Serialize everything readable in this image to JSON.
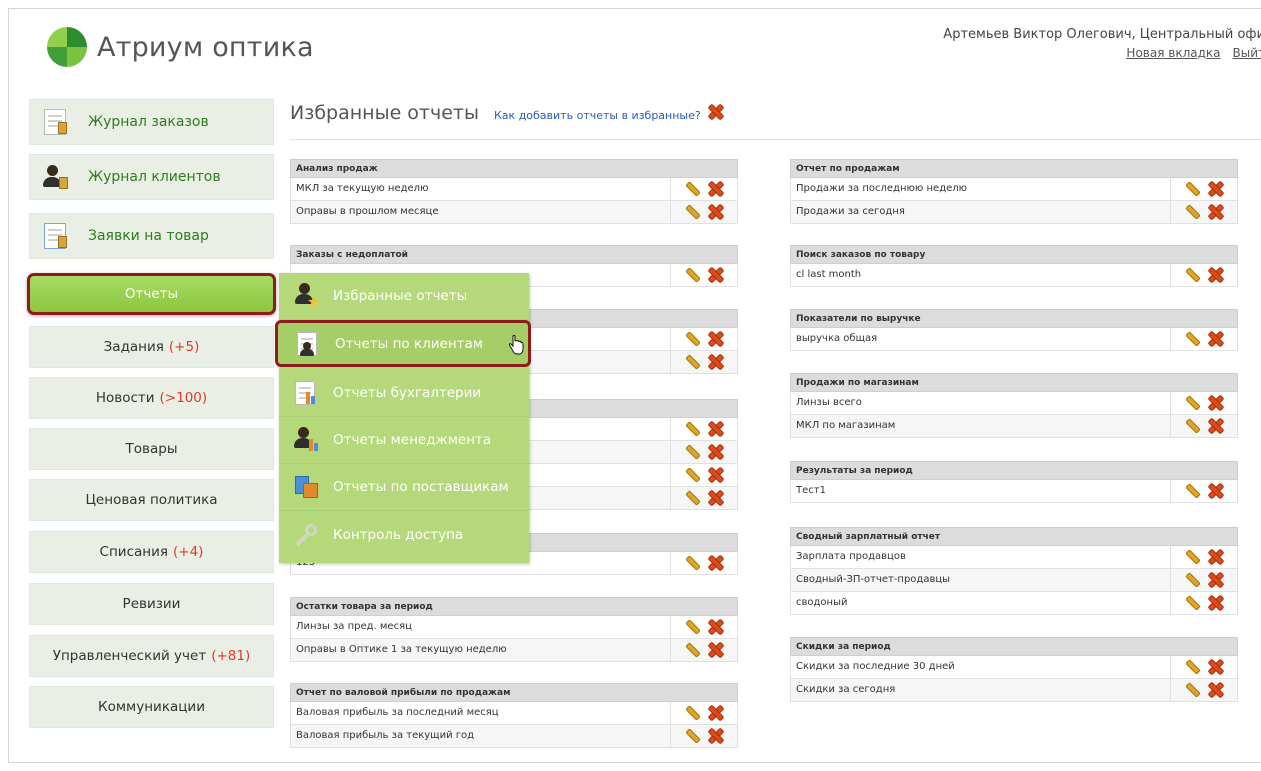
{
  "header": {
    "app_title": "Атриум оптика",
    "user": "Артемьев Виктор Олегович, Центральный офи",
    "links": [
      "Новая вкладка",
      "Выйт"
    ]
  },
  "sidebar": {
    "items": [
      {
        "label": "Журнал заказов",
        "count": ""
      },
      {
        "label": "Журнал клиентов",
        "count": ""
      },
      {
        "label": "Заявки на товар",
        "count": ""
      },
      {
        "label": "Отчеты",
        "count": ""
      },
      {
        "label": "Задания",
        "count": "(+5)"
      },
      {
        "label": "Новости",
        "count": "(>100)"
      },
      {
        "label": "Товары",
        "count": ""
      },
      {
        "label": "Ценовая политика",
        "count": ""
      },
      {
        "label": "Списания",
        "count": "(+4)"
      },
      {
        "label": "Ревизии",
        "count": ""
      },
      {
        "label": "Управленческий учет",
        "count": "(+81)"
      },
      {
        "label": "Коммуникации",
        "count": ""
      }
    ]
  },
  "menu": {
    "items": [
      {
        "label": "Избранные отчеты"
      },
      {
        "label": "Отчеты по клиентам"
      },
      {
        "label": "Отчеты бухгалтерии"
      },
      {
        "label": "Отчеты менеджмента"
      },
      {
        "label": "Отчеты по поставщикам"
      },
      {
        "label": "Контроль доступа"
      }
    ]
  },
  "content": {
    "title": "Избранные отчеты",
    "help_link": "Как добавить отчеты в избранные?"
  },
  "left_groups": [
    {
      "title": "Анализ продаж",
      "rows": [
        "МКЛ за текущую неделю",
        "Оправы в прошлом месяце"
      ]
    },
    {
      "title": "Заказы с недоплатой",
      "rows": [
        ""
      ]
    },
    {
      "title": "",
      "rows": [
        "",
        ""
      ]
    },
    {
      "title": "",
      "rows": [
        "",
        "",
        "",
        ""
      ]
    },
    {
      "title": "",
      "rows": [
        "123"
      ]
    },
    {
      "title": "Остатки товара за период",
      "rows": [
        "Линзы за пред. месяц",
        "Оправы в Оптике 1 за текущую неделю"
      ]
    },
    {
      "title": "Отчет по валовой прибыли по продажам",
      "rows": [
        "Валовая прибыль за последний месяц",
        "Валовая прибыль за текущий год"
      ]
    }
  ],
  "right_groups": [
    {
      "title": "Отчет по продажам",
      "rows": [
        "Продажи за последнюю неделю",
        "Продажи за сегодня"
      ]
    },
    {
      "title": "Поиск заказов по товару",
      "rows": [
        "cl last month"
      ]
    },
    {
      "title": "Показатели по выручке",
      "rows": [
        "выручка общая"
      ]
    },
    {
      "title": "Продажи по магазинам",
      "rows": [
        "Линзы всего",
        "МКЛ по магазинам"
      ]
    },
    {
      "title": "Результаты за период",
      "rows": [
        "Тест1"
      ]
    },
    {
      "title": "Сводный зарплатный отчет",
      "rows": [
        "Зарплата продавцов",
        "Сводный-ЗП-отчет-продавцы",
        "сводоный"
      ]
    },
    {
      "title": "Скидки за период",
      "rows": [
        "Скидки за последние 30 дней",
        "Скидки за сегодня"
      ]
    }
  ]
}
